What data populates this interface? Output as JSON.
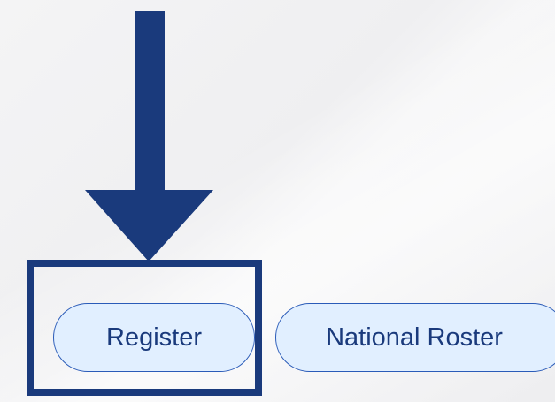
{
  "buttons": {
    "register_label": "Register",
    "national_roster_label": "National Roster"
  },
  "annotation": {
    "arrow_color": "#1a3a7c",
    "box_color": "#1a3a7c",
    "target": "Register"
  },
  "colors": {
    "button_fill": "#e1efff",
    "button_border": "#2a5bb8",
    "button_text": "#1a3a7c",
    "background": "#f2f2f3"
  },
  "icons": {
    "arrow": "arrow-down-icon"
  }
}
